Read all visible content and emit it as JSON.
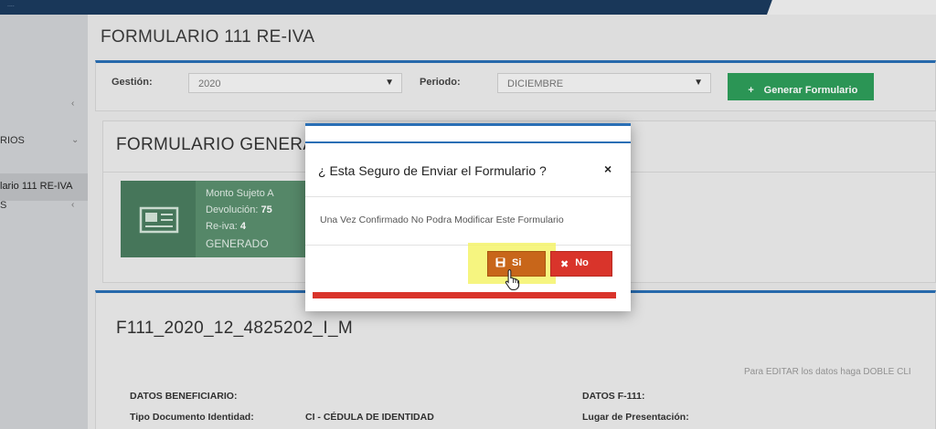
{
  "topbar": {
    "corner_text": "...."
  },
  "sidebar": {
    "items": [
      {
        "label": "RIOS",
        "chevron": "⌄"
      },
      {
        "label": "lario 111 RE-IVA"
      },
      {
        "label": "S",
        "chevron": "‹"
      }
    ],
    "top_chevron": "‹"
  },
  "page": {
    "title": "FORMULARIO 111 RE-IVA"
  },
  "filters": {
    "gestion_label": "Gestión:",
    "gestion_value": "2020",
    "periodo_label": "Periodo:",
    "periodo_value": "DICIEMBRE",
    "generate_button": "Generar Formulario"
  },
  "generated": {
    "title": "FORMULARIO GENERA",
    "info": {
      "line1": "Monto Sujeto A",
      "devolucion_label": "Devolución:",
      "devolucion_value": "75",
      "reiva_label": "Re-iva:",
      "reiva_value": "4",
      "status": "GENERADO"
    }
  },
  "detail": {
    "title": "F111_2020_12_4825202_I_M",
    "edit_hint": "Para EDITAR los datos haga DOBLE CLI",
    "datos_beneficiario": "DATOS BENEFICIARIO:",
    "tipo_doc_label": "Tipo Documento Identidad:",
    "tipo_doc_value": "CI - CÉDULA DE IDENTIDAD",
    "datos_f111": "DATOS F-111:",
    "lugar_label": "Lugar de Presentación:"
  },
  "modal": {
    "title": "¿ Esta Seguro de Enviar el Formulario ?",
    "close": "×",
    "body": "Una Vez Confirmado No Podra Modificar Este Formulario",
    "yes_label": "Si",
    "no_label": "No"
  },
  "colors": {
    "primary": "#2a6fb5",
    "success": "#2e9d5a",
    "warning": "#c8661a",
    "danger": "#d9342b"
  }
}
